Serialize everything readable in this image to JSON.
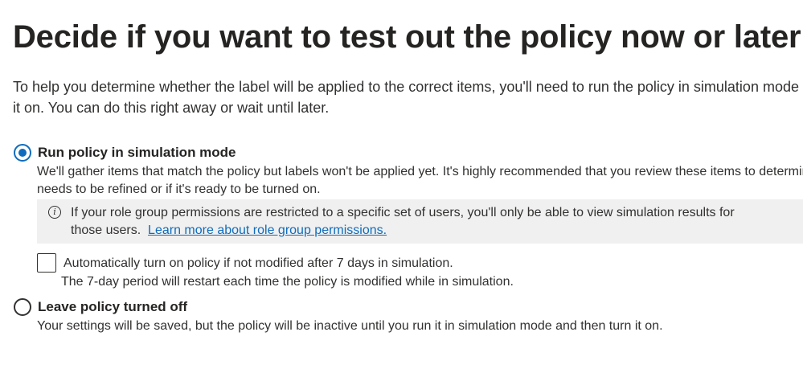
{
  "page": {
    "title": "Decide if you want to test out the policy now or later",
    "intro_line1": "To help you determine whether the label will be applied to the correct items, you'll need to run the policy in simulation mode before you turn",
    "intro_line2": "it on. You can do this right away or wait until later."
  },
  "options": {
    "simulation": {
      "label": "Run policy in simulation mode",
      "selected": true,
      "desc_line1": "We'll gather items that match the policy but labels won't be applied yet. It's highly recommended that you review these items to determine if the policy",
      "desc_line2": "needs to be refined or if it's ready to be turned on."
    },
    "off": {
      "label": "Leave policy turned off",
      "selected": false,
      "desc": "Your settings will be saved, but the policy will be inactive until you run it in simulation mode and then turn it on."
    }
  },
  "info": {
    "icon": "info-icon",
    "line1": "If your role group permissions are restricted to a specific set of users, you'll only be able to view simulation results for",
    "line2_prefix": "those users.",
    "link": "Learn more about role group permissions."
  },
  "auto_turn_on": {
    "checked": false,
    "label": "Automatically turn on policy if not modified after 7 days in simulation.",
    "desc": "The 7-day period will restart each time the policy is modified while in simulation."
  },
  "colors": {
    "accent": "#0f6cbd",
    "text": "#323130",
    "info_bg": "#f0f0f0"
  }
}
